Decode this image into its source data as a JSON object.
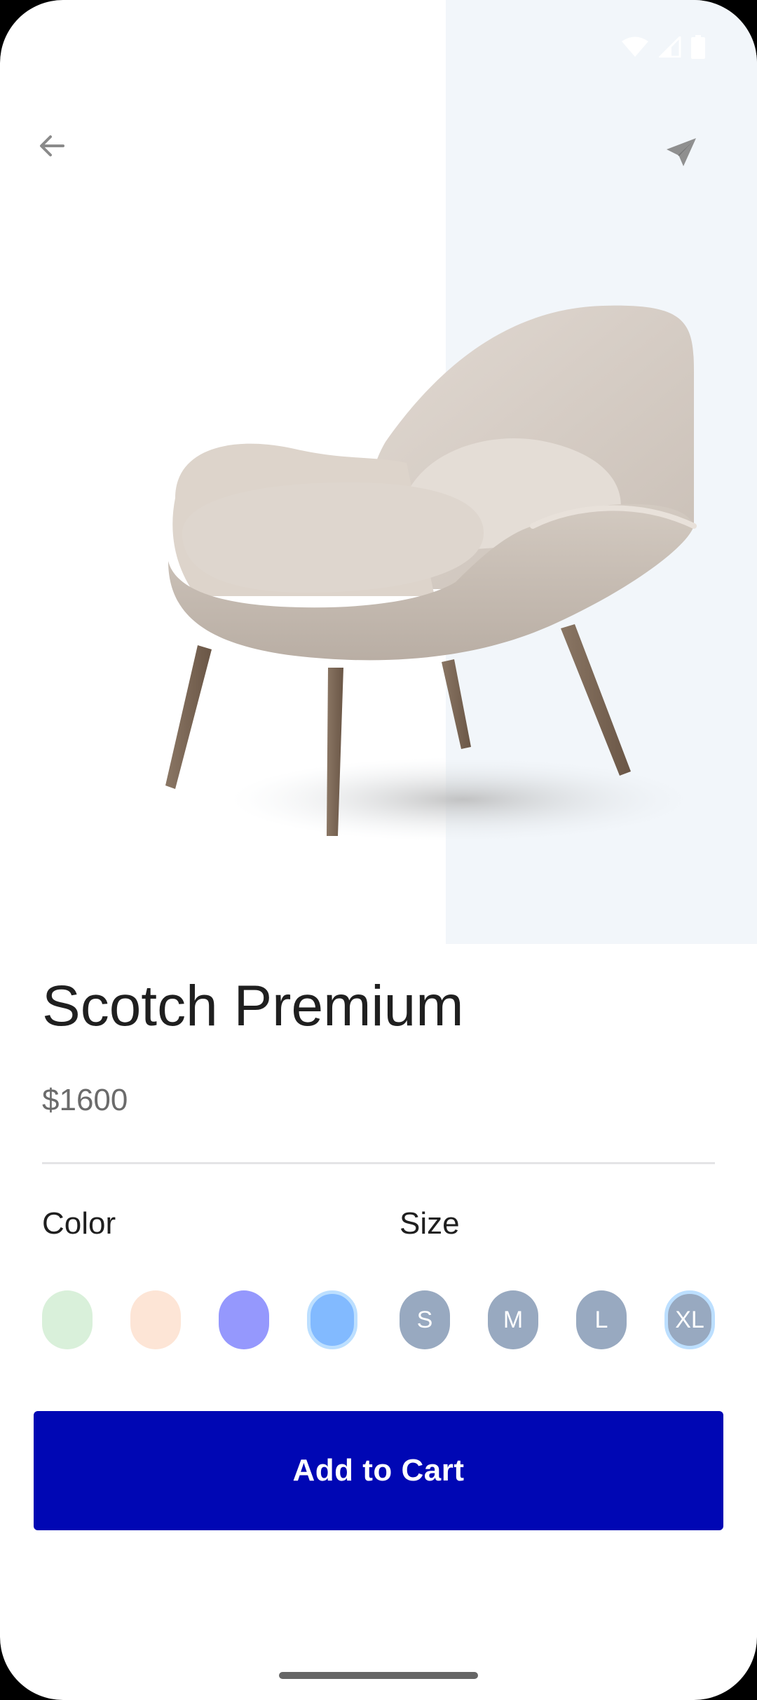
{
  "product": {
    "title": "Scotch Premium",
    "price": "$1600"
  },
  "options": {
    "color_label": "Color",
    "size_label": "Size",
    "colors": [
      {
        "hex": "#d9f0da",
        "selected": false
      },
      {
        "hex": "#fde5d6",
        "selected": false
      },
      {
        "hex": "#9598fd",
        "selected": false
      },
      {
        "hex": "#82baff",
        "selected": true
      }
    ],
    "sizes": [
      {
        "label": "S",
        "selected": false
      },
      {
        "label": "M",
        "selected": false
      },
      {
        "label": "L",
        "selected": false
      },
      {
        "label": "XL",
        "selected": true
      }
    ]
  },
  "actions": {
    "add_to_cart_label": "Add to Cart"
  },
  "icons": {
    "back": "arrow-left-icon",
    "share": "send-icon",
    "status": [
      "wifi-icon",
      "cellular-signal-icon",
      "battery-icon"
    ]
  },
  "theme": {
    "accent": "#0007b4",
    "hero_background": "#f2f6fa",
    "size_chip": "#98a9c0"
  }
}
